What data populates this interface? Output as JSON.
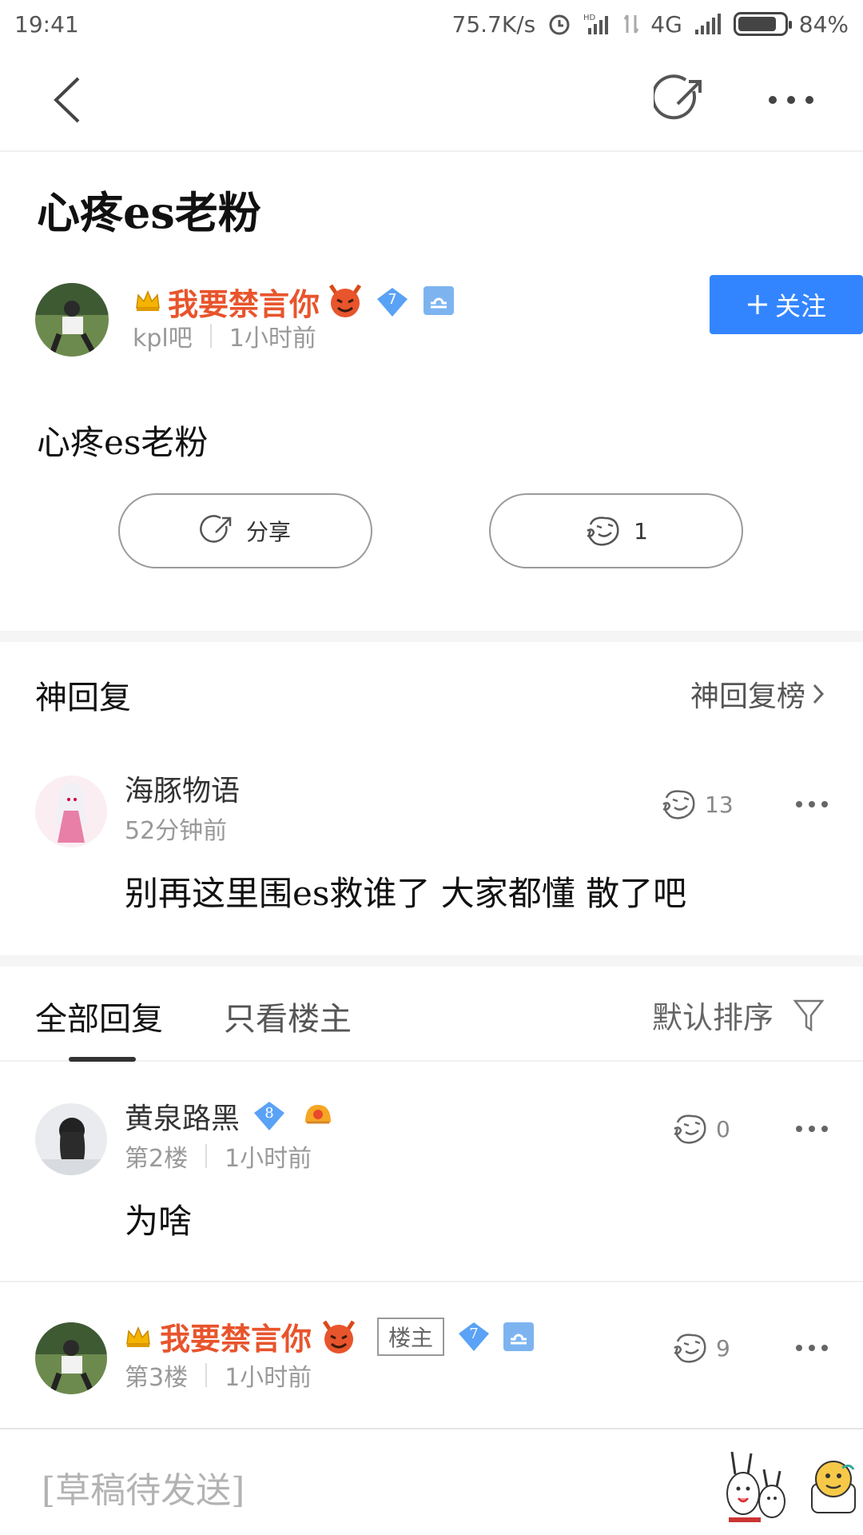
{
  "status_bar": {
    "time": "19:41",
    "speed": "75.7K/s",
    "network": "4G",
    "battery": "84%",
    "battery_level": 0.84
  },
  "post": {
    "title": "心疼es老粉",
    "body": "心疼es老粉",
    "author": {
      "name": "我要禁言你",
      "level": "7",
      "forum": "kpl吧",
      "time": "1小时前"
    },
    "follow_label": "关注",
    "share_label": "分享",
    "like_count": "1"
  },
  "god_reply": {
    "heading": "神回复",
    "board_label": "神回复榜",
    "item": {
      "name": "海豚物语",
      "time": "52分钟前",
      "likes": "13",
      "text": "别再这里围es救谁了 大家都懂 散了吧"
    }
  },
  "tabs": {
    "all": "全部回复",
    "only_op": "只看楼主",
    "sort": "默认排序"
  },
  "replies": [
    {
      "name": "黄泉路黑",
      "level": "8",
      "floor": "第2楼",
      "time": "1小时前",
      "likes": "0",
      "text": "为啥"
    },
    {
      "name": "我要禁言你",
      "level": "7",
      "tag": "楼主",
      "floor": "第3楼",
      "time": "1小时前",
      "likes": "9"
    }
  ],
  "bottom": {
    "draft": "[草稿待发送]"
  },
  "colors": {
    "accent": "#3385ff",
    "author_red": "#e8542c"
  }
}
